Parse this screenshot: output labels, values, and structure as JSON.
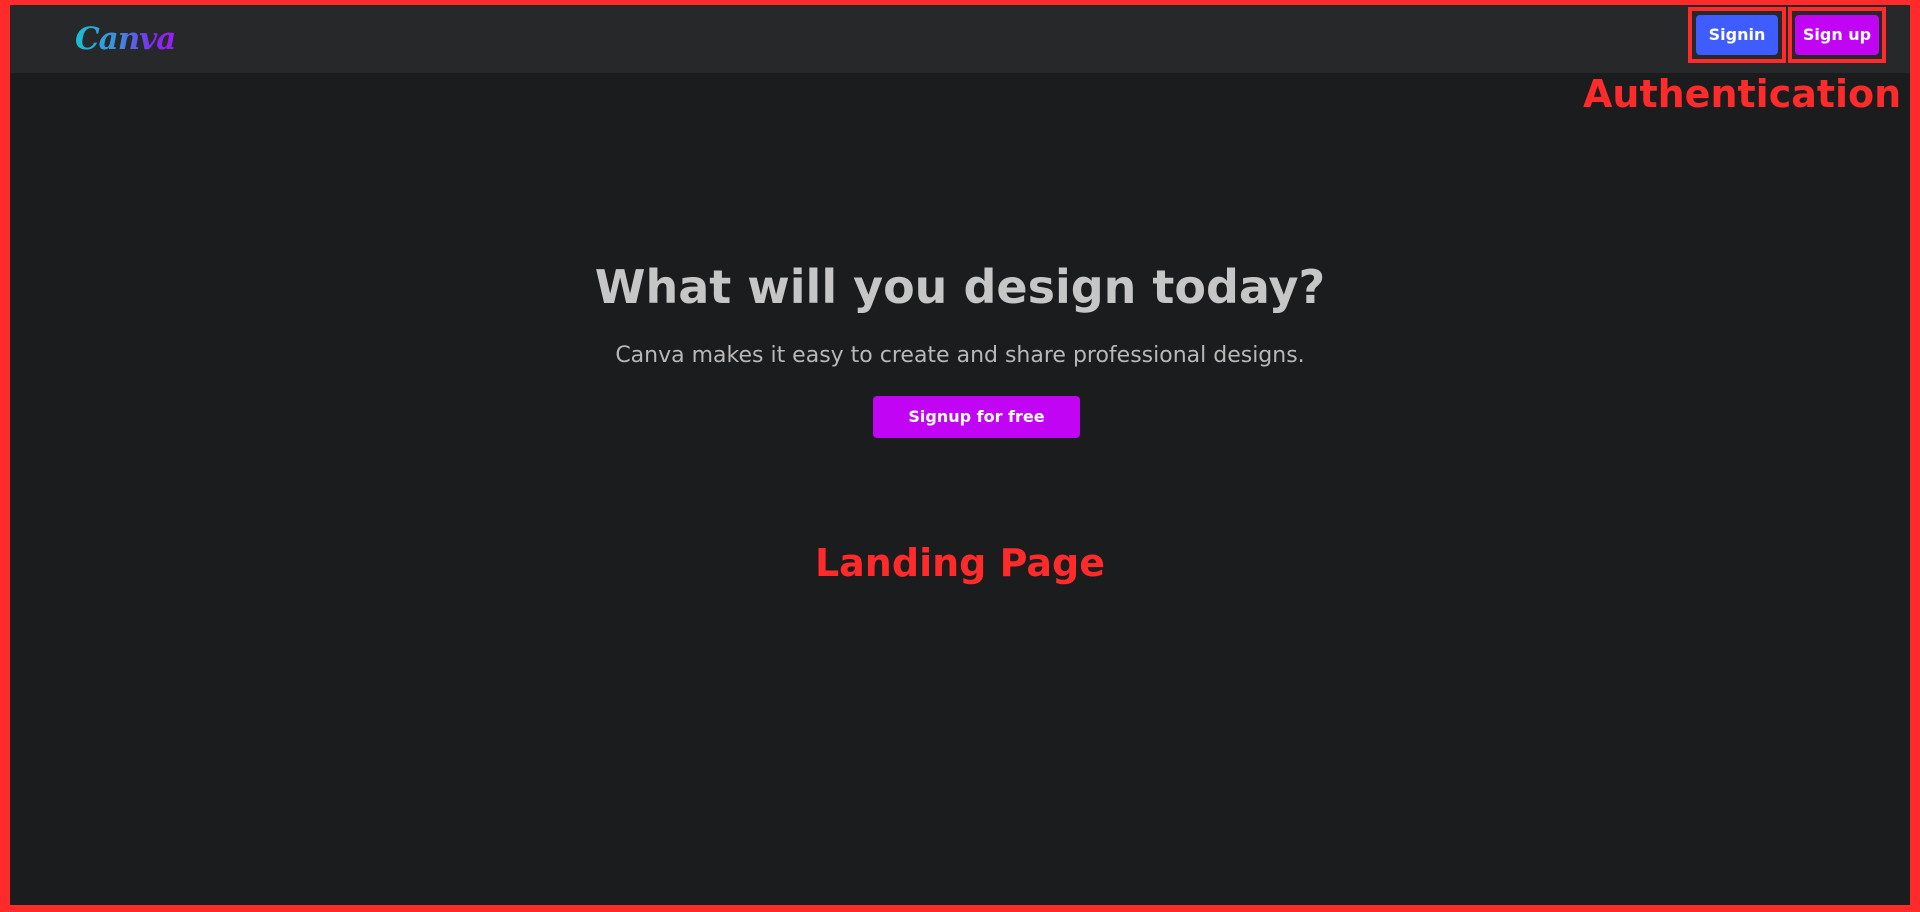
{
  "navbar": {
    "logo_text": "Canva",
    "signin_label": "Signin",
    "signup_label": "Sign up"
  },
  "hero": {
    "title": "What will you design today?",
    "subtitle": "Canva makes it easy to create and share professional designs.",
    "cta_label": "Signup for free"
  },
  "annotations": {
    "authentication": "Authentication",
    "landing_page": "Landing Page"
  },
  "colors": {
    "annotation_red": "#ff2a2a",
    "page_background": "#1b1c1e",
    "navbar_background": "#27282a",
    "signin_blue": "#3e5cff",
    "brand_purple": "#c204f4"
  }
}
